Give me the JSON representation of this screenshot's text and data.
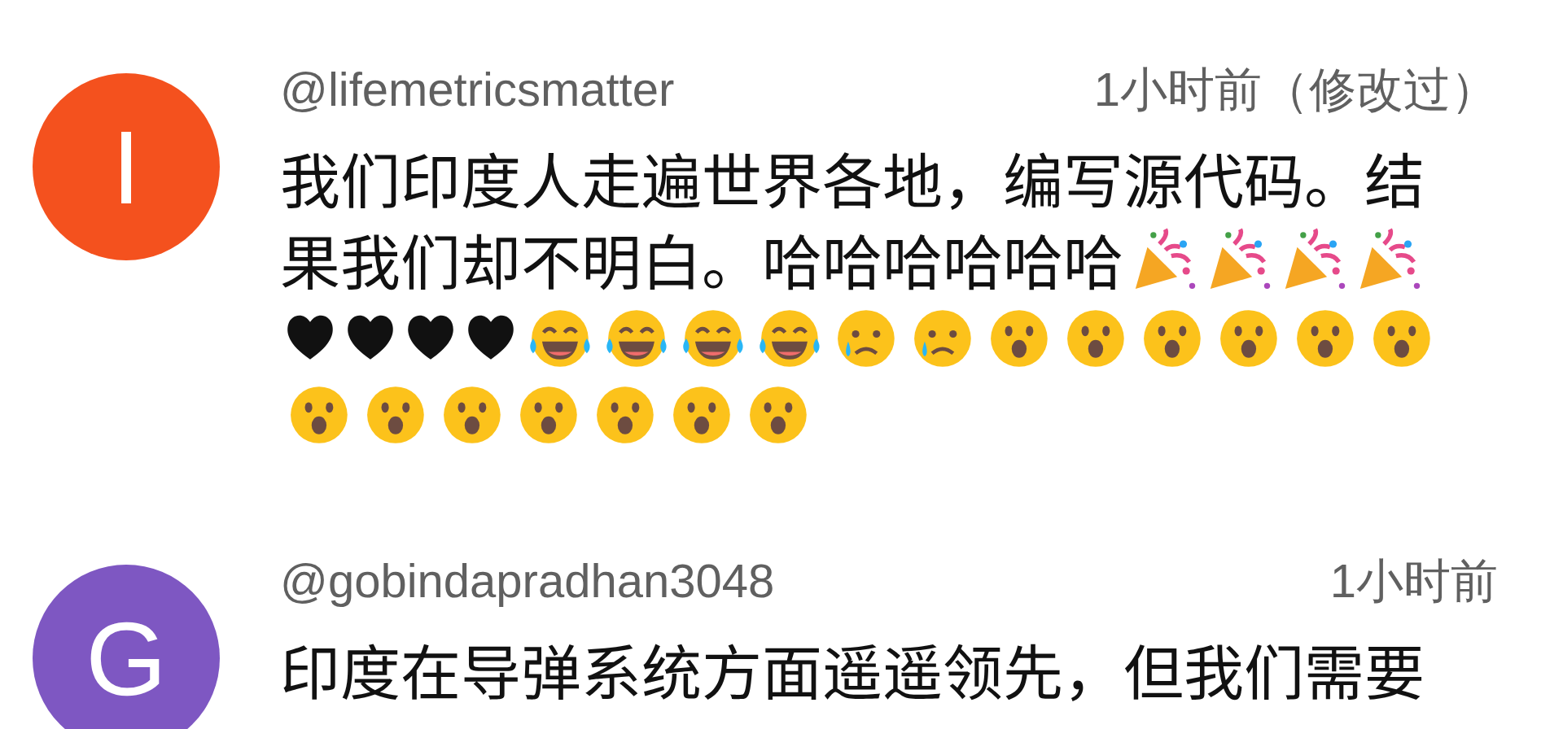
{
  "comments": [
    {
      "avatar_letter": "I",
      "color": "#f4511e",
      "author": "@lifemetricsmatter",
      "time": "1小时前（修改过）",
      "text": "我们印度人走遍世界各地，编写源代码。结果我们却不明白。哈哈哈哈哈哈",
      "emojis": [
        {
          "kind": "party"
        },
        {
          "kind": "party"
        },
        {
          "kind": "party"
        },
        {
          "kind": "party"
        },
        {
          "kind": "heart"
        },
        {
          "kind": "heart"
        },
        {
          "kind": "heart"
        },
        {
          "kind": "heart"
        },
        {
          "kind": "laugh"
        },
        {
          "kind": "laugh"
        },
        {
          "kind": "laugh"
        },
        {
          "kind": "laugh"
        },
        {
          "kind": "sad"
        },
        {
          "kind": "sad"
        },
        {
          "kind": "surprised"
        },
        {
          "kind": "surprised"
        },
        {
          "kind": "surprised"
        },
        {
          "kind": "surprised"
        },
        {
          "kind": "surprised"
        },
        {
          "kind": "surprised"
        },
        {
          "kind": "surprised"
        },
        {
          "kind": "surprised"
        },
        {
          "kind": "surprised"
        },
        {
          "kind": "surprised"
        },
        {
          "kind": "surprised"
        },
        {
          "kind": "surprised"
        },
        {
          "kind": "surprised"
        }
      ]
    },
    {
      "avatar_letter": "G",
      "color": "#7e57c2",
      "author": "@gobindapradhan3048",
      "time": "1小时前",
      "text": "印度在导弹系统方面遥遥领先，但我们需要"
    }
  ]
}
